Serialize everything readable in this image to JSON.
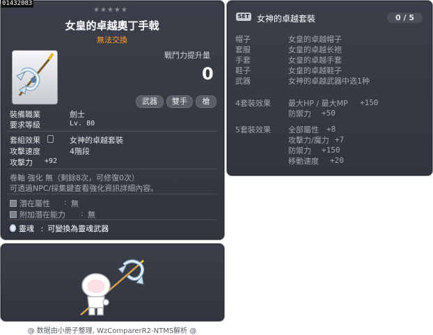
{
  "item": {
    "id": "01432083",
    "stars": "★★★★★",
    "name": "女皇的卓越奧丁手戟",
    "trade": "無法交換",
    "power_label": "戰鬥力提升量",
    "power_value": "0",
    "tags": [
      "武器",
      "雙手",
      "槍"
    ],
    "job_label": "裝備職業",
    "job_value": "劍士",
    "req_label": "要求等級",
    "req_value": "Lv. 80",
    "set_label": "套組效果",
    "set_value": "女神的卓越套裝",
    "speed_label": "攻擊速度",
    "speed_value": "4階段",
    "atk_label": "攻擊力",
    "atk_value": "+92",
    "upgrade_line": "卷軸 強化 無（剩餘8次，可修復0次）",
    "npc_line": "可透過NPC/採集鍵查看強化資訊詳細內容。",
    "potential_label": "潛在屬性",
    "potential_value": "無",
    "add_potential_label": "附加潛在能力",
    "add_potential_value": "無",
    "soul_label": "靈魂",
    "soul_value": "可變換為靈魂武器"
  },
  "set": {
    "badge": "SET",
    "name": "女神的卓越套裝",
    "count": "0 / 5",
    "parts": [
      {
        "slot": "帽子",
        "name": "女皇的卓越帽子"
      },
      {
        "slot": "套服",
        "name": "女皇的卓越长袍"
      },
      {
        "slot": "手套",
        "name": "女皇的卓越手套"
      },
      {
        "slot": "鞋子",
        "name": "女皇的卓越鞋子"
      },
      {
        "slot": "武器",
        "name": "女神的卓越武器中选1种"
      }
    ],
    "effect4": {
      "label": "4套裝效果",
      "line1": "最大HP / 最大MP",
      "line1_val": "+150",
      "line2": "防禦力",
      "line2_val": "+50"
    },
    "effect5": {
      "label": "5套裝效果",
      "lines": [
        {
          "k": "全部屬性",
          "v": "+8"
        },
        {
          "k": "攻擊力/魔力",
          "v": "+7"
        },
        {
          "k": "防禦力",
          "v": "+150"
        },
        {
          "k": "移動速度",
          "v": "+20"
        }
      ]
    }
  },
  "footer": "@ 数据由小册子整理, WzComparerR2-NTMS解析 @",
  "colors": {
    "panel": "#353944",
    "trade": "#ff9b2e",
    "border": "#8e8f93"
  }
}
